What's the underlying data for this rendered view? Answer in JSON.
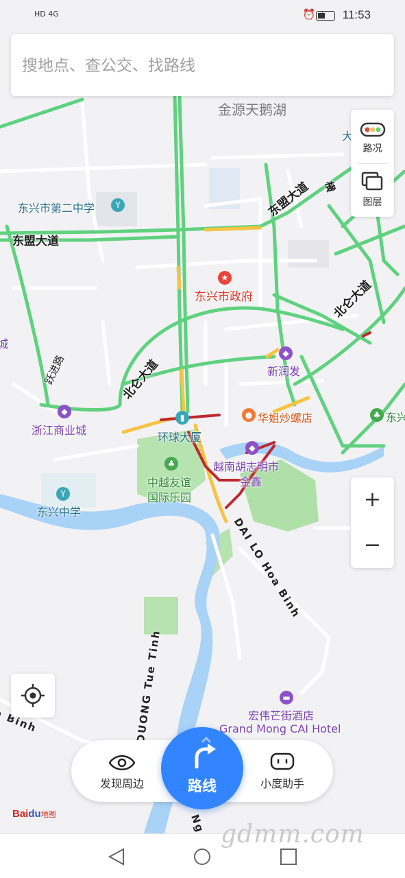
{
  "status_bar": {
    "network": "HD 4G",
    "time": "11:53",
    "icons": [
      "alarm-icon",
      "location-icon",
      "battery-icon"
    ]
  },
  "search": {
    "placeholder": "搜地点、查公交、找路线"
  },
  "layer_panel": {
    "traffic_label": "路况",
    "layers_label": "图层"
  },
  "zoom": {
    "in": "+",
    "out": "−"
  },
  "map": {
    "area_labels": [
      "金源天鹅湖"
    ],
    "road_labels": {
      "dongmeng_left": "东盟大道",
      "dongmeng_right": "东盟大道",
      "beilun_center": "北仑大道",
      "beilun_right": "北仑大道",
      "left_diag": "跃进路"
    },
    "pois": {
      "school2": "东兴市第二中学",
      "gov": "东兴市政府",
      "xinrunfa": "新润发",
      "zhejiang": "浙江商业城",
      "huanqiu": "环球大厦",
      "huajie": "华姐炒螺店",
      "zhongyue_1": "中越友谊",
      "zhongyue_2": "国际乐园",
      "yuenan_1": "越南胡志明市",
      "yuenan_2": "金鑫",
      "dongxing_school": "东兴中学",
      "dongxing_right": "东兴",
      "hotel_cn": "宏伟芒街酒店",
      "hotel_en": "Grand Mong CAI Hotel",
      "partial_left": "城",
      "partial_top_right": "大",
      "partial_right_vertical": "横"
    },
    "vn_roads": {
      "hoa_binh": "DAI LO Hoa Binh",
      "tue_tinh": "DUONG Tue Tinh",
      "a_binh": "a Binh",
      "ng": "Ng"
    },
    "colors": {
      "smooth": "#5fd17f",
      "slow": "#f6c343",
      "jam": "#c0272d",
      "river": "#a9d2f7",
      "park": "#b6e3b0",
      "road": "#ffffff"
    }
  },
  "dock": {
    "discover_label": "发现周边",
    "route_label": "路线",
    "assistant_label": "小度助手"
  },
  "logo": {
    "text": "Bai",
    "paw": "du",
    "sub": "地图"
  },
  "watermark": "gdmm.com"
}
